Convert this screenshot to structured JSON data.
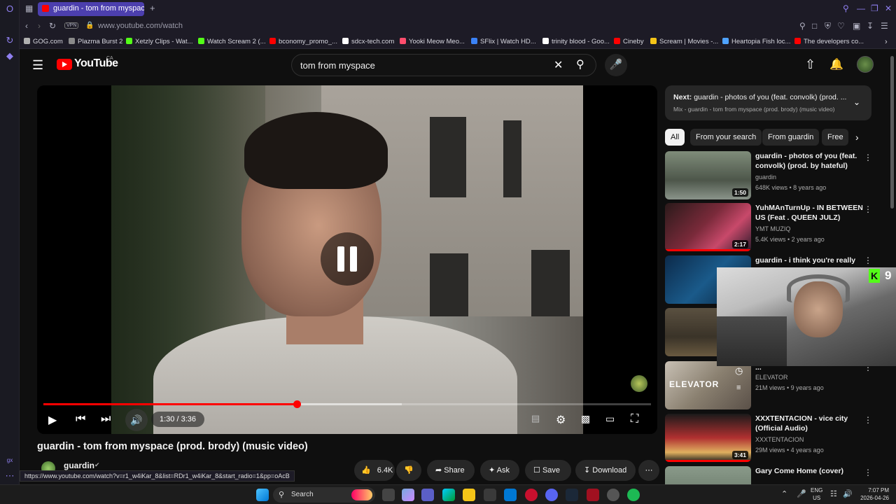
{
  "browser": {
    "tab_title": "guardin - tom from myspace",
    "url": "www.youtube.com/watch",
    "vpn_label": "VPN",
    "status_url": "https://www.youtube.com/watch?v=r1_w4iKar_8&list=RDr1_w4iKar_8&start_radio=1&pp=oAcB"
  },
  "bookmarks": [
    {
      "label": "GOG.com",
      "color": "#b0b0b0"
    },
    {
      "label": "Plazma Burst 2",
      "color": "#8a8a8a"
    },
    {
      "label": "Xetzly Clips - Wat...",
      "color": "#53fc18"
    },
    {
      "label": "Watch Scream 2 (...",
      "color": "#53fc18"
    },
    {
      "label": "bconomy_promo_...",
      "color": "#ff0000"
    },
    {
      "label": "sdcx-tech.com",
      "color": "#ffffff"
    },
    {
      "label": "Yooki Meow Meo...",
      "color": "#ff4d6d"
    },
    {
      "label": "SFlix | Watch HD...",
      "color": "#3b82f6"
    },
    {
      "label": "trinity blood - Goo...",
      "color": "#ffffff"
    },
    {
      "label": "Cineby",
      "color": "#ff0000"
    },
    {
      "label": "Scream | Movies -...",
      "color": "#f5c518"
    },
    {
      "label": "Heartopia Fish loc...",
      "color": "#4fa3ff"
    },
    {
      "label": "The developers co...",
      "color": "#ff0000"
    }
  ],
  "youtube": {
    "logo_text": "YouTube",
    "region": "CA",
    "search_value": "tom from myspace"
  },
  "player": {
    "time_current": "1:30",
    "time_total": "3:36",
    "time_display": "1:30 / 3:36",
    "progress_fraction": 0.4167,
    "buffered_fraction": 0.59
  },
  "video": {
    "title": "guardin - tom from myspace (prod. brody) (music video)",
    "channel": "guardin",
    "likes": "6.4K",
    "share_label": "Share",
    "ask_label": "Ask",
    "save_label": "Save",
    "download_label": "Download"
  },
  "upnext": {
    "next_prefix": "Next:",
    "next_title": "guardin - photos of you (feat. convolk) (prod. ...",
    "mix_title": "Mix - guardin - tom from myspace (prod. brody) (music video)"
  },
  "chips": [
    "All",
    "From your search",
    "From guardin",
    "Free"
  ],
  "recommendations": [
    {
      "title": "guardin - photos of you (feat. convolk) (prod. by hateful)",
      "channel": "guardin",
      "meta": "648K views • 8 years ago",
      "duration": "1:50"
    },
    {
      "title": "YuhMAnTurnUp - IN BETWEEN US (Feat . QUEEN JULZ)",
      "channel": "YMT MUZIQ",
      "meta": "5.4K views • 2 years ago",
      "duration": "2:17"
    },
    {
      "title": "guardin - i think you're really",
      "channel": "",
      "meta": "",
      "duration": ""
    },
    {
      "title": "",
      "channel": "",
      "meta": "",
      "duration": ""
    },
    {
      "title": "...",
      "channel": "ELEVATOR",
      "meta": "21M views • 9 years ago",
      "duration": ""
    },
    {
      "title": "XXXTENTACION - vice city (Official Audio)",
      "channel": "XXXTENTACION",
      "meta": "29M views • 4 years ago",
      "duration": "3:41"
    },
    {
      "title": "Gary Come Home (cover)",
      "channel": "",
      "meta": "",
      "duration": ""
    }
  ],
  "thumb_texts": {
    "elevator": "ELEVATOR"
  },
  "webcam_badge": "9",
  "taskbar": {
    "search_label": "Search",
    "lang": "ENG",
    "region": "US",
    "time": "7:07 PM",
    "date": "2026-04-26"
  }
}
